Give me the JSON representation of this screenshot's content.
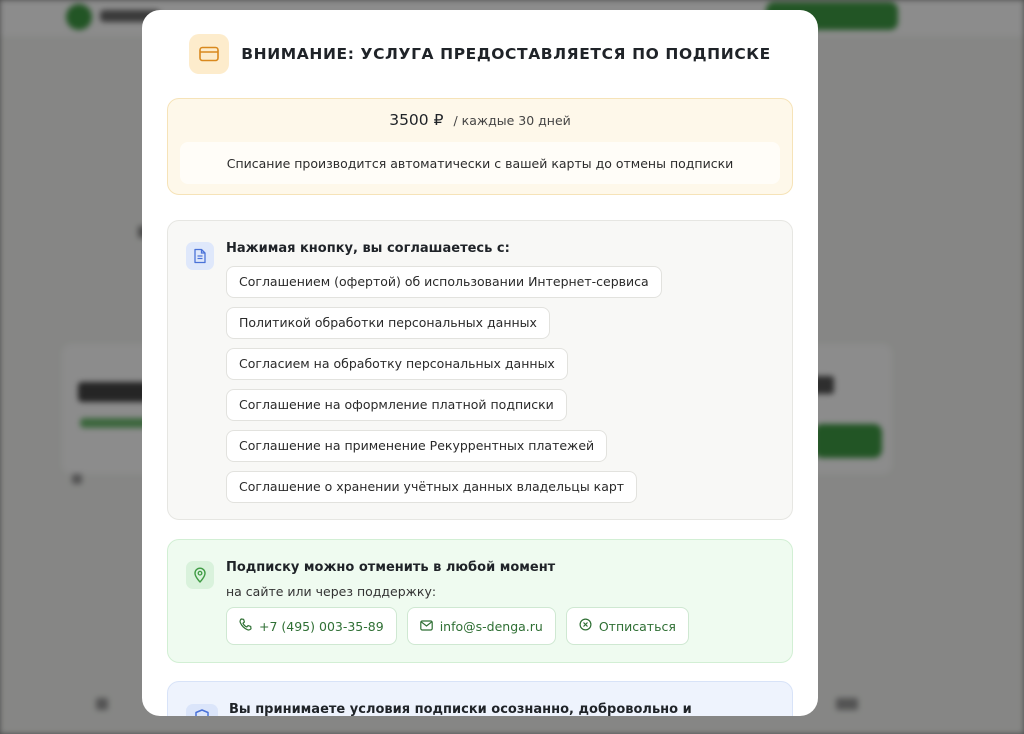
{
  "modal": {
    "title": "ВНИМАНИЕ: УСЛУГА ПРЕДОСТАВЛЯЕТСЯ ПО ПОДПИСКЕ",
    "header_icon": "credit-card-icon",
    "accent_color": "#d9891e"
  },
  "price": {
    "amount": "3500 ₽",
    "period": "/ каждые 30 дней",
    "note": "Списание производится автоматически с вашей карты до отмены подписки"
  },
  "agreements": {
    "icon": "document-icon",
    "title": "Нажимая кнопку, вы соглашаетесь с:",
    "items": [
      "Соглашением (офертой) об использовании Интернет-сервиса",
      "Политикой обработки персональных данных",
      "Согласием на обработку персональных данных",
      "Соглашение на оформление платной подписки",
      "Соглашение на применение Рекуррентных платежей",
      "Соглашение о хранении учётных данных владельцы карт"
    ]
  },
  "cancel": {
    "icon": "location-pin-icon",
    "title": "Подписку можно отменить в любой момент",
    "subtitle": "на сайте или через поддержку:",
    "phone": "+7 (495) 003-35-89",
    "email": "info@s-denga.ru",
    "unsubscribe": "Отписаться",
    "accent_color": "#3f9b44"
  },
  "consent": {
    "icon": "shield-icon",
    "text": "Вы принимаете условия подписки осознанно, добровольно и информированно."
  }
}
